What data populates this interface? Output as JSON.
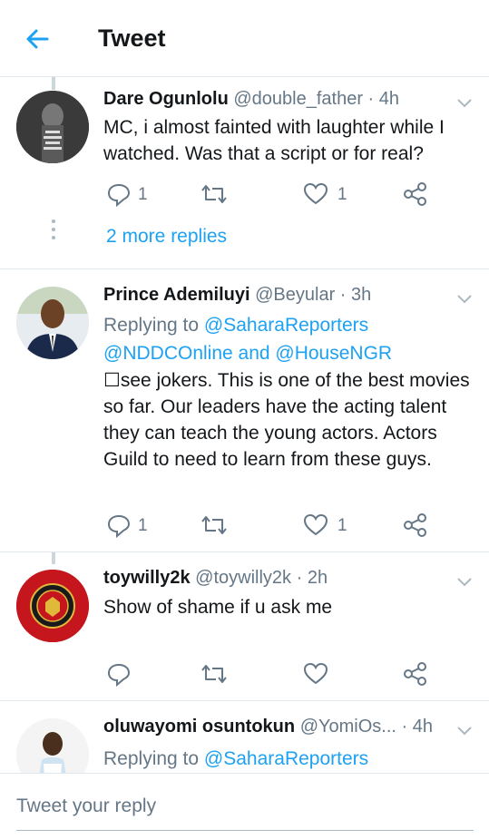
{
  "header": {
    "title": "Tweet"
  },
  "tweets": [
    {
      "name": "Dare Ogunlolu",
      "meta": "@double_father · 4h",
      "text": "MC, i almost fainted with laughter while I watched. Was that a script or for real?",
      "replies": "1",
      "likes": "1",
      "avatar_colors": [
        "#3a3a3a",
        "#b8b8b8"
      ]
    },
    {
      "name": "Prince Ademiluyi",
      "meta": "@Beyular · 3h",
      "replying_prefix": "Replying to ",
      "replying_line1": "@SaharaReporters",
      "replying_line2": "@NDDCOnline and @HouseNGR",
      "text": "☐see jokers. This is one of the best movies so far. Our leaders have the acting talent they can teach the young actors. Actors Guild to need to learn from these guys.",
      "replies": "1",
      "likes": "1"
    },
    {
      "name": "toywilly2k",
      "meta": "@toywilly2k · 2h",
      "text": "Show of shame if u ask me",
      "replies": "",
      "likes": ""
    },
    {
      "name": "oluwayomi osuntokun",
      "meta": "@YomiOs...  · 4h",
      "replying_prefix": "Replying to ",
      "replying_line1": "@SaharaReporters"
    }
  ],
  "more_replies": "2 more replies",
  "reply_box": {
    "placeholder": "Tweet your reply"
  },
  "colors": {
    "accent": "#1da1f2",
    "secondary_text": "#657786",
    "divider": "#e1e8ed"
  }
}
